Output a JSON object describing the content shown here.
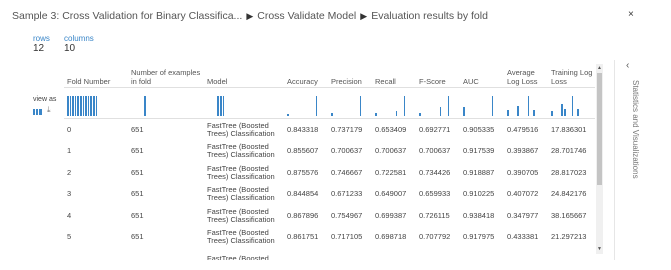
{
  "breadcrumb": {
    "item1": "Sample 3: Cross Validation for Binary Classifica...",
    "item2": "Cross Validate Model",
    "item3": "Evaluation results by fold",
    "separator": "▶"
  },
  "close_label": "×",
  "meta": {
    "rows_label": "rows",
    "rows_value": "12",
    "columns_label": "columns",
    "columns_value": "10"
  },
  "view_as": {
    "label": "view as",
    "histogram_icon": "histogram-icon",
    "download_icon": "download-icon",
    "download_glyph": "⤓"
  },
  "table": {
    "headers": [
      "Fold Number",
      "Number of examples in fold",
      "Model",
      "Accuracy",
      "Precision",
      "Recall",
      "F-Score",
      "AUC",
      "Average Log Loss",
      "Training Log Loss"
    ],
    "rows": [
      [
        "0",
        "651",
        "FastTree (Boosted Trees) Classification",
        "0.843318",
        "0.737179",
        "0.653409",
        "0.692771",
        "0.905335",
        "0.479516",
        "17.836301"
      ],
      [
        "1",
        "651",
        "FastTree (Boosted Trees) Classification",
        "0.855607",
        "0.700637",
        "0.700637",
        "0.700637",
        "0.917539",
        "0.393867",
        "28.701746"
      ],
      [
        "2",
        "651",
        "FastTree (Boosted Trees) Classification",
        "0.875576",
        "0.746667",
        "0.722581",
        "0.734426",
        "0.918887",
        "0.390705",
        "28.817023"
      ],
      [
        "3",
        "651",
        "FastTree (Boosted Trees) Classification",
        "0.844854",
        "0.671233",
        "0.649007",
        "0.659933",
        "0.910225",
        "0.407072",
        "24.842176"
      ],
      [
        "4",
        "651",
        "FastTree (Boosted Trees) Classification",
        "0.867896",
        "0.754967",
        "0.699387",
        "0.726115",
        "0.938418",
        "0.347977",
        "38.165667"
      ],
      [
        "5",
        "651",
        "FastTree (Boosted Trees) Classification",
        "0.861751",
        "0.717105",
        "0.698718",
        "0.707792",
        "0.917975",
        "0.433381",
        "21.297213"
      ],
      [
        "",
        "",
        "FastTree (Boosted",
        "",
        "",
        "",
        "",
        "",
        "",
        ""
      ]
    ],
    "histograms": [
      [
        1,
        1,
        1,
        1,
        1,
        1,
        1,
        1,
        1,
        1,
        1,
        1
      ],
      [
        0,
        0,
        0,
        0,
        0,
        1,
        0,
        0,
        0,
        0,
        0,
        0
      ],
      [
        0,
        0,
        0,
        0,
        1,
        1,
        1,
        0,
        0,
        0,
        0,
        0
      ],
      [
        0.1,
        0,
        0,
        0,
        0,
        0,
        0,
        0,
        0,
        0,
        0,
        1
      ],
      [
        0.15,
        0,
        0,
        0,
        0,
        0,
        0,
        0,
        0,
        0,
        0,
        1
      ],
      [
        0.15,
        0,
        0,
        0,
        0,
        0,
        0,
        0,
        0.25,
        0,
        0,
        1
      ],
      [
        0.15,
        0,
        0,
        0,
        0,
        0,
        0,
        0,
        0.45,
        0,
        0,
        1
      ],
      [
        0.45,
        0,
        0,
        0,
        0,
        0,
        0,
        0,
        0,
        0,
        0,
        1
      ],
      [
        0.3,
        0,
        0,
        0,
        0.5,
        0,
        0,
        0,
        1,
        0,
        0.3,
        0
      ],
      [
        0.25,
        0,
        0,
        0,
        0.6,
        0.35,
        0,
        0,
        1,
        0,
        0.35,
        0
      ]
    ]
  },
  "side_panel": {
    "label": "Statistics and Visualizations",
    "chevron": "‹"
  },
  "scrollbar": {
    "up": "▲",
    "down": "▼"
  },
  "colors": {
    "accent": "#3a86c8"
  }
}
